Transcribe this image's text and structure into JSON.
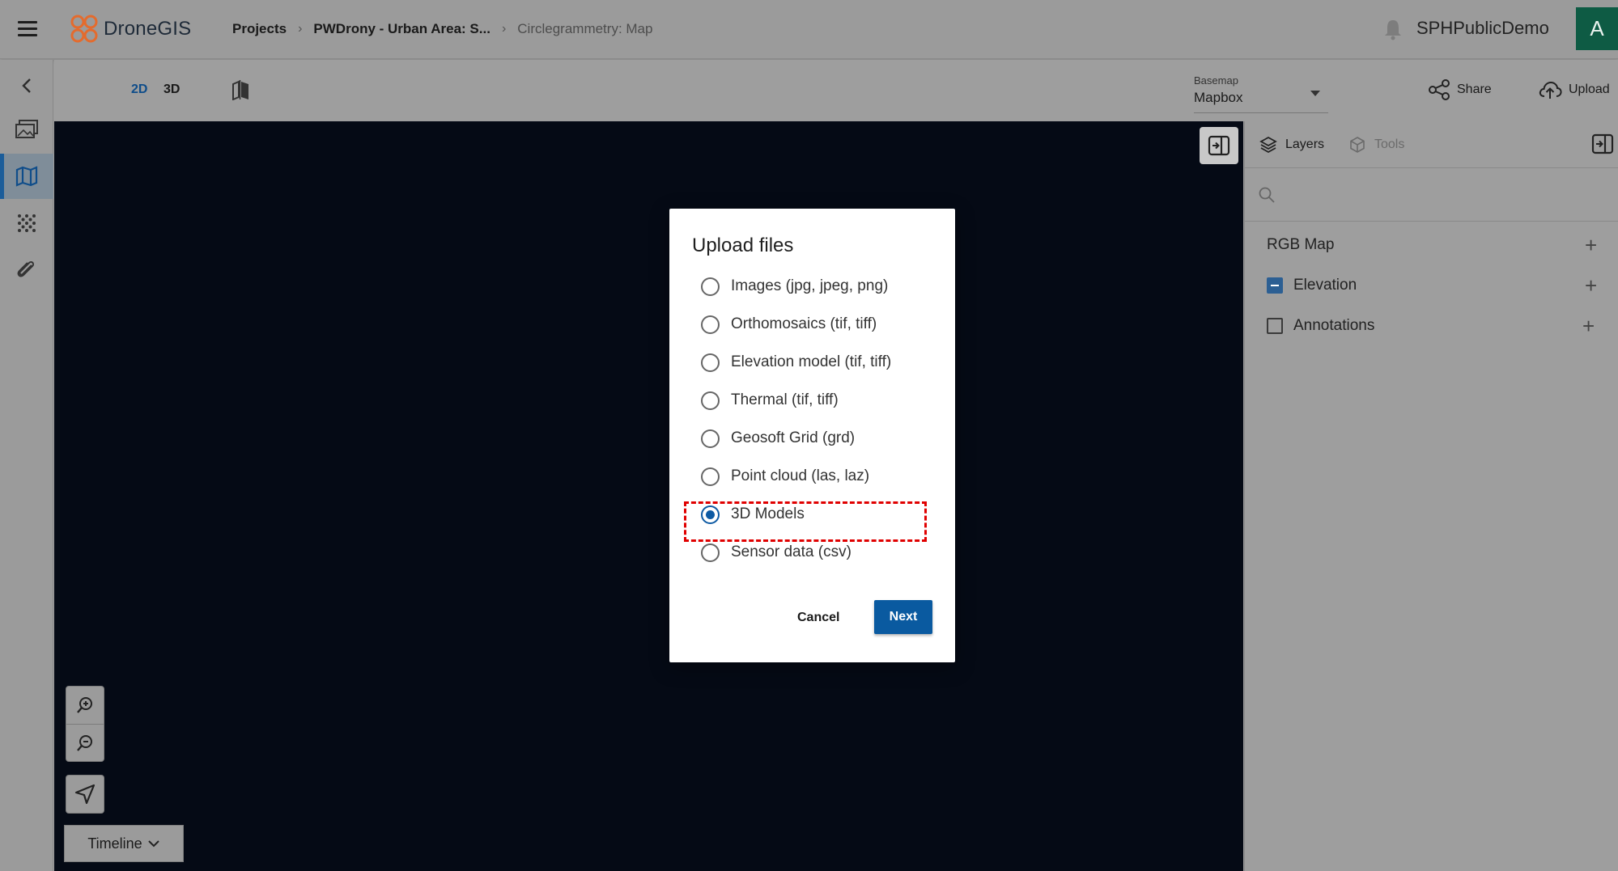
{
  "app": {
    "name": "DroneGIS",
    "user": "SPHPublicDemo",
    "avatar_letter": "A"
  },
  "breadcrumbs": [
    {
      "label": "Projects"
    },
    {
      "label": "PWDrony - Urban Area: S..."
    },
    {
      "label": "Circlegrammetry: Map"
    }
  ],
  "toolbar": {
    "mode_2d": "2D",
    "mode_3d": "3D",
    "basemap_label": "Basemap",
    "basemap_value": "Mapbox",
    "share_label": "Share",
    "upload_label": "Upload"
  },
  "map_controls": {
    "timeline_label": "Timeline"
  },
  "right_panel": {
    "tabs": [
      {
        "label": "Layers",
        "active": true
      },
      {
        "label": "Tools",
        "active": false
      }
    ],
    "layers": [
      {
        "label": "RGB Map",
        "type": "group"
      },
      {
        "label": "Elevation",
        "checkbox": "indeterminate"
      },
      {
        "label": "Annotations",
        "checkbox": "unchecked"
      }
    ]
  },
  "modal": {
    "title": "Upload files",
    "options": [
      {
        "label": "Images (jpg, jpeg, png)",
        "checked": false
      },
      {
        "label": "Orthomosaics (tif, tiff)",
        "checked": false
      },
      {
        "label": "Elevation model (tif, tiff)",
        "checked": false
      },
      {
        "label": "Thermal (tif, tiff)",
        "checked": false
      },
      {
        "label": "Geosoft Grid (grd)",
        "checked": false
      },
      {
        "label": "Point cloud (las, laz)",
        "checked": false
      },
      {
        "label": "3D Models",
        "checked": true
      },
      {
        "label": "Sensor data (csv)",
        "checked": false
      }
    ],
    "cancel_label": "Cancel",
    "next_label": "Next"
  },
  "colors": {
    "brand_orange": "#e46b2d",
    "accent_blue": "#0a5aa0",
    "map_background": "#050a15",
    "avatar_green": "#0e5b44",
    "highlight_red": "#e00000"
  }
}
